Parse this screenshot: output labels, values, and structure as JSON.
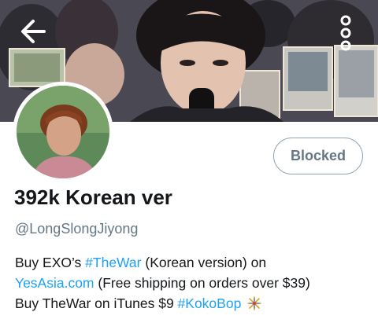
{
  "header": {
    "back_icon": "arrow-left-icon",
    "more_icon": "more-vertical-icon"
  },
  "profile": {
    "display_name": "392k Korean ver",
    "handle": "@LongSlongJiyong",
    "relationship_button_label": "Blocked",
    "bio": {
      "line1": {
        "prefix": "Buy EXO’s ",
        "hashtag": "#TheWar",
        "suffix": " (Korean version) on"
      },
      "line2": {
        "link": "YesAsia.com",
        "suffix": " (Free shipping on orders over $39)"
      },
      "line3": {
        "prefix": "Buy TheWar on iTunes $9 ",
        "hashtag": "#KokoBop",
        "emoji": "sparkle-emoji"
      }
    }
  },
  "colors": {
    "link": "#1da1f2",
    "secondary_text": "#657786",
    "primary_text": "#14171a"
  }
}
